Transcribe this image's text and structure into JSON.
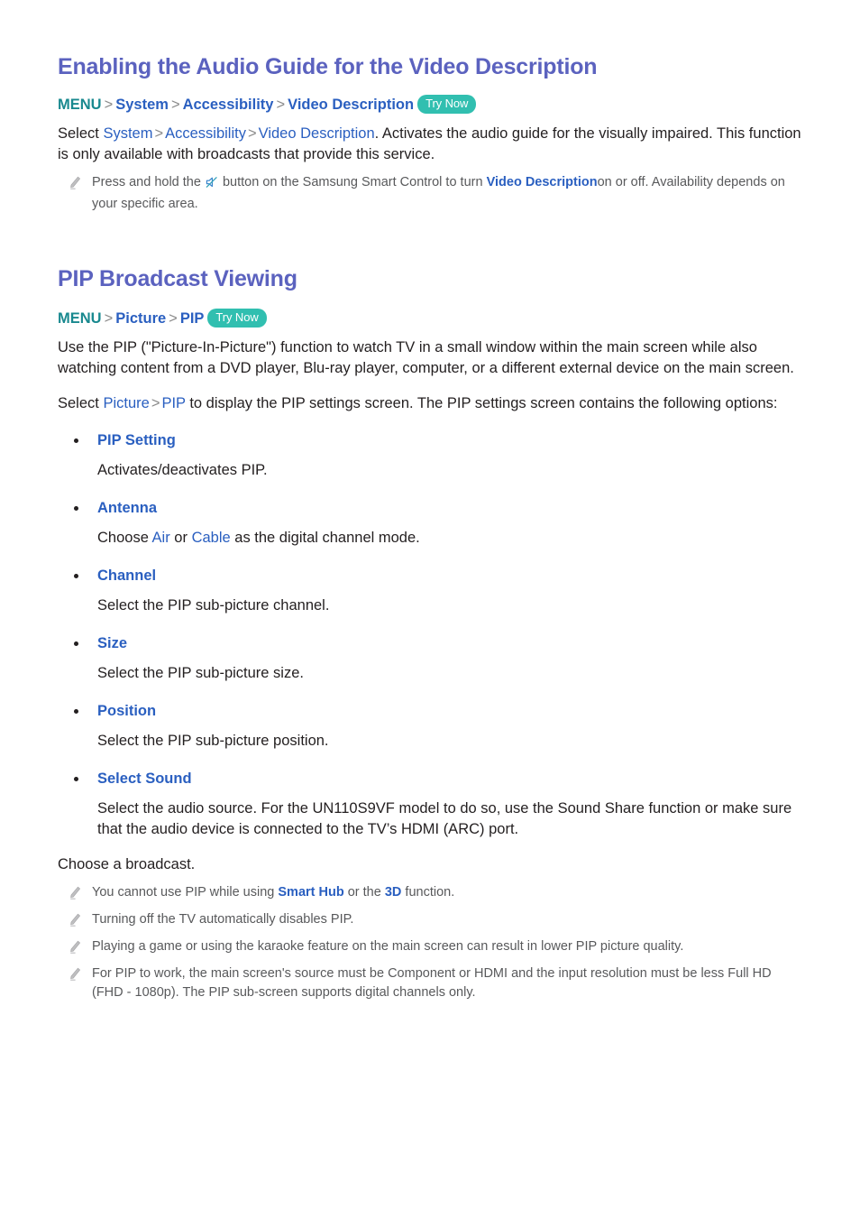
{
  "colors": {
    "heading": "#5b62bf",
    "link": "#2a5fc0",
    "menu_root": "#19898f",
    "badge_bg": "#31bfb0",
    "body_text": "#231f20",
    "note_text": "#58595b"
  },
  "section1": {
    "title": "Enabling the Audio Guide for the Video Description",
    "menu_path": {
      "root": "MENU",
      "sep": ">",
      "items": [
        "System",
        "Accessibility",
        "Video Description"
      ],
      "badge": "Try Now"
    },
    "paragraph": {
      "lead": "Select ",
      "link1": "System",
      "link2": "Accessibility",
      "link3": "Video Description",
      "tail": ". Activates the audio guide for the visually impaired. This function is only available with broadcasts that provide this service."
    },
    "note": {
      "icon": "pencil-icon",
      "part1": "Press and hold the",
      "inline_icon": "mute-button-icon",
      "part2": "button on the Samsung Smart Control to turn",
      "link": "Video Description",
      "part3": "on or off. Availability depends on your specific area."
    }
  },
  "section2": {
    "title": "PIP Broadcast Viewing",
    "menu_path": {
      "root": "MENU",
      "sep": ">",
      "items": [
        "Picture",
        "PIP"
      ],
      "badge": "Try Now"
    },
    "intro": "Use the PIP (\"Picture-In-Picture\") function to watch TV in a small window within the main screen while also watching content from a DVD player, Blu-ray player, computer, or a different external device on the main screen.",
    "select_line": {
      "lead": "Select ",
      "link1": "Picture",
      "link2": "PIP",
      "tail": " to display the PIP settings screen. The PIP settings screen contains the following options:"
    },
    "options": [
      {
        "label": "PIP Setting",
        "desc": "Activates/deactivates PIP."
      },
      {
        "label": "Antenna",
        "desc_pre": "Choose ",
        "desc_link1": "Air",
        "desc_mid": " or ",
        "desc_link2": "Cable",
        "desc_post": " as the digital channel mode.",
        "desc": "Choose Air or Cable as the digital channel mode."
      },
      {
        "label": "Channel",
        "desc": "Select the PIP sub-picture channel."
      },
      {
        "label": "Size",
        "desc": "Select the PIP sub-picture size."
      },
      {
        "label": "Position",
        "desc": "Select the PIP sub-picture position."
      },
      {
        "label": "Select Sound",
        "desc": "Select the audio source. For the UN110S9VF model to do so, use the Sound Share function or make sure that the audio device is connected to the TV’s HDMI (ARC) port."
      }
    ],
    "closing": "Choose a broadcast.",
    "notes": [
      {
        "pre": "You cannot use PIP while using ",
        "link1": "Smart Hub",
        "mid": " or the ",
        "link2": "3D",
        "post": " function."
      },
      {
        "text": "Turning off the TV automatically disables PIP."
      },
      {
        "text": "Playing a game or using the karaoke feature on the main screen can result in lower PIP picture quality."
      },
      {
        "text": "For PIP to work, the main screen's source must be Component or HDMI and the input resolution must be less Full HD (FHD - 1080p). The PIP sub-screen supports digital channels only."
      }
    ]
  }
}
